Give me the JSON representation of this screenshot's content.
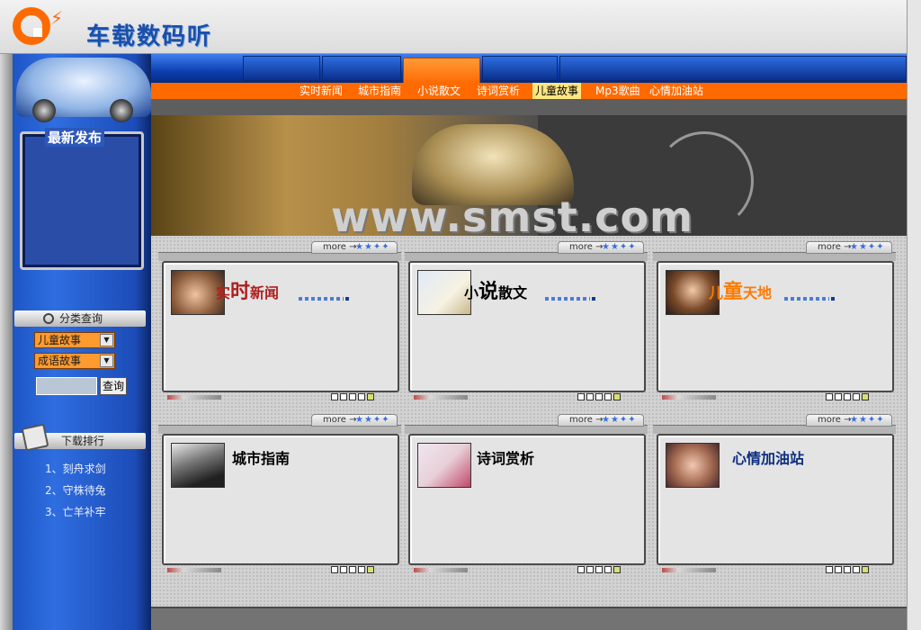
{
  "logo": {
    "text": "车载数码听"
  },
  "sidebar": {
    "latest_title": "最新发布",
    "category_header": "分类查询",
    "select_1": "儿童故事",
    "select_2": "成语故事",
    "search_button": "查询",
    "download_header": "下载排行",
    "rankings": [
      "1、刻舟求剑",
      "2、守株待兔",
      "3、亡羊补牢"
    ]
  },
  "nav": {
    "items": [
      "实时新闻",
      "城市指南",
      "小说散文",
      "诗词赏析",
      "儿童故事",
      "Mp3歌曲",
      "心情加油站"
    ]
  },
  "banner": {
    "text": "www.smst.com"
  },
  "panels": [
    {
      "title_a": "实",
      "title_b": "时",
      "title_c": "新闻",
      "more": "more →",
      "accent": "#b01e1e"
    },
    {
      "title_a": "小",
      "title_b": "说",
      "title_c": "散文",
      "more": "more →",
      "accent": "#111111"
    },
    {
      "title_a": "儿",
      "title_b": "童",
      "title_c": "天地",
      "more": "more →",
      "accent": "#ff7a00"
    },
    {
      "title": "城市指南",
      "more": "more →",
      "accent": "#111111"
    },
    {
      "title": "诗词赏析",
      "more": "more →",
      "accent": "#111111"
    },
    {
      "title": "心情加油站",
      "more": "more →",
      "accent": "#0d2f80"
    }
  ],
  "icons": {
    "logo": "logo-o-icon",
    "query": "magnifier-icon",
    "download": "download-icon",
    "more_stars": "stars-icon"
  },
  "colors": {
    "nav_orange": "#ff6a00",
    "nav_blue": "#0d3fb0",
    "sidebar_blue": "#2f6ee0"
  }
}
